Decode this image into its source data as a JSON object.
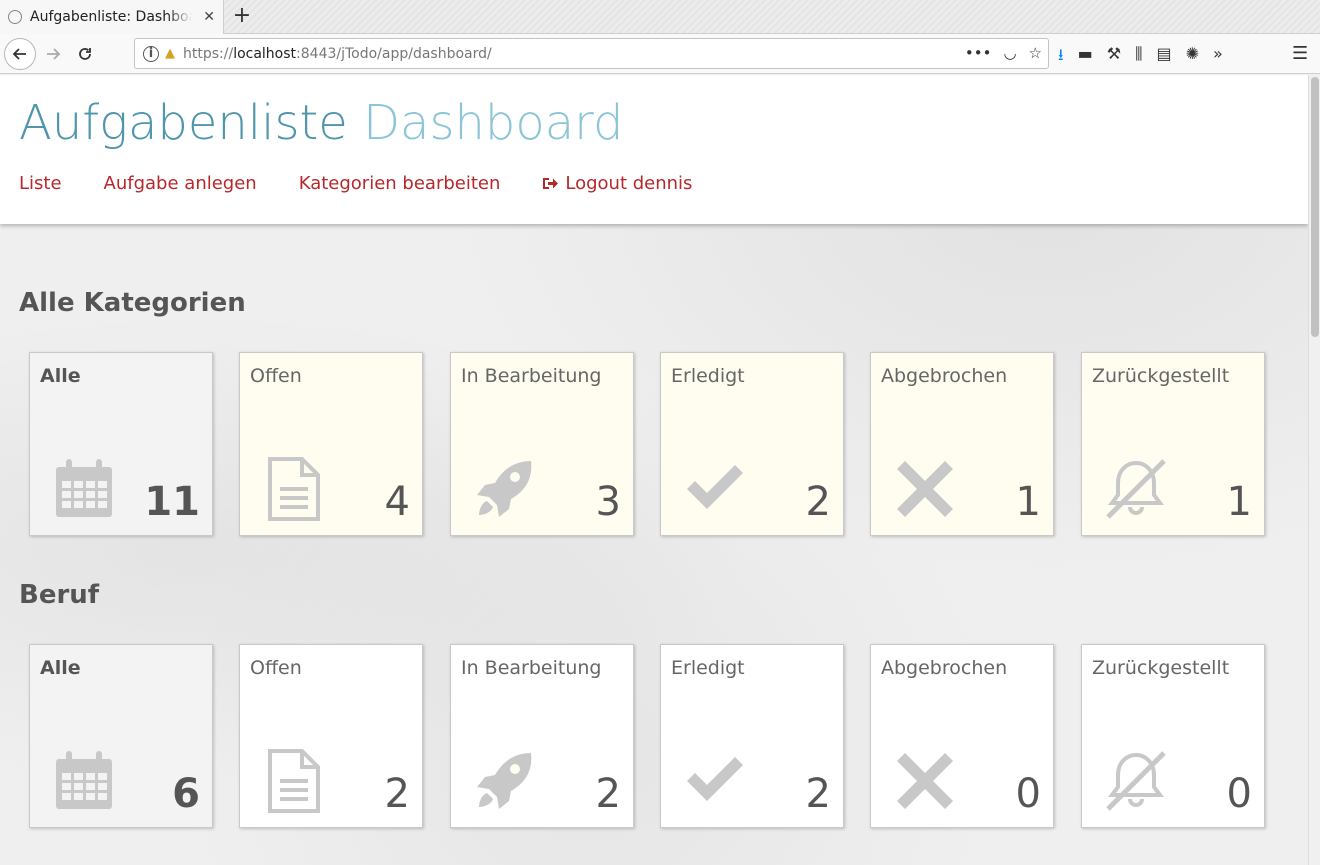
{
  "browser": {
    "tab_title": "Aufgabenliste: Dashboard",
    "tab_close": "✕",
    "new_tab": "+",
    "url_prefix": "https://",
    "url_host": "localhost",
    "url_rest": ":8443/jTodo/app/dashboard/"
  },
  "header": {
    "brand_main": "Aufgabenliste",
    "brand_sub": "Dashboard",
    "menu": [
      {
        "label": "Liste"
      },
      {
        "label": "Aufgabe anlegen"
      },
      {
        "label": "Kategorien bearbeiten"
      },
      {
        "label": "Logout dennis"
      }
    ]
  },
  "sections": [
    {
      "title": "Alle Kategorien",
      "cards": [
        {
          "label": "Alle",
          "count": "11",
          "icon": "calendar-icon"
        },
        {
          "label": "Offen",
          "count": "4",
          "icon": "document-icon"
        },
        {
          "label": "In Bearbeitung",
          "count": "3",
          "icon": "rocket-icon"
        },
        {
          "label": "Erledigt",
          "count": "2",
          "icon": "check-icon"
        },
        {
          "label": "Abgebrochen",
          "count": "1",
          "icon": "cross-icon"
        },
        {
          "label": "Zurückgestellt",
          "count": "1",
          "icon": "bell-slash-icon"
        }
      ]
    },
    {
      "title": "Beruf",
      "cards": [
        {
          "label": "Alle",
          "count": "6",
          "icon": "calendar-icon"
        },
        {
          "label": "Offen",
          "count": "2",
          "icon": "document-icon"
        },
        {
          "label": "In Bearbeitung",
          "count": "2",
          "icon": "rocket-icon"
        },
        {
          "label": "Erledigt",
          "count": "2",
          "icon": "check-icon"
        },
        {
          "label": "Abgebrochen",
          "count": "0",
          "icon": "cross-icon"
        },
        {
          "label": "Zurückgestellt",
          "count": "0",
          "icon": "bell-slash-icon"
        }
      ]
    }
  ],
  "colors": {
    "brand_main": "#4e95ad",
    "brand_sub": "#8cc4d8",
    "menu": "#b8272b",
    "status_card": "#fffdf0",
    "icon": "#c8c8c8"
  }
}
